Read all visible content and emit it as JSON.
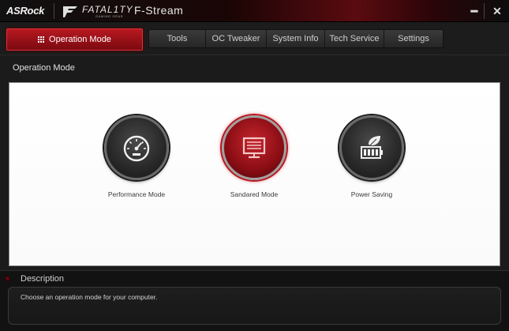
{
  "titlebar": {
    "brand": "ASRock",
    "fatality_text": "FATAL1TY",
    "fatality_sub": "GAMING GEAR",
    "app_title": "F-Stream",
    "minimize_label": "━",
    "close_label": "✕"
  },
  "nav": {
    "active_label": "Operation Mode",
    "tabs": [
      {
        "label": "Tools"
      },
      {
        "label": "OC Tweaker"
      },
      {
        "label": "System Info"
      },
      {
        "label": "Tech Service"
      },
      {
        "label": "Settings"
      }
    ]
  },
  "section_title": "Operation Mode",
  "modes": [
    {
      "label": "Performance Mode",
      "icon": "speedometer-icon",
      "selected": false
    },
    {
      "label": "Sandared Mode",
      "icon": "monitor-icon",
      "selected": true
    },
    {
      "label": "Power Saving",
      "icon": "leaf-battery-icon",
      "selected": false
    }
  ],
  "description": {
    "title": "Description",
    "text": "Choose an operation mode for your computer."
  },
  "colors": {
    "accent": "#c6252d",
    "background": "#1b1b1b",
    "panel": "#ffffff"
  }
}
